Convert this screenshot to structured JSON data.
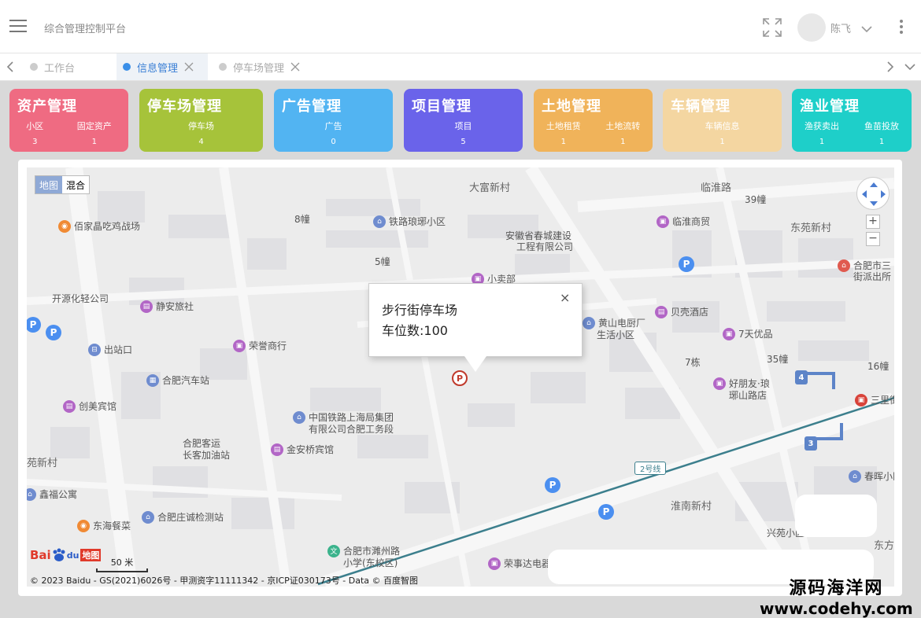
{
  "header": {
    "title": "综合管理控制平台",
    "username": "陈飞"
  },
  "tabs": [
    {
      "label": "工作台",
      "active": false
    },
    {
      "label": "信息管理",
      "active": true
    },
    {
      "label": "停车场管理",
      "active": false
    }
  ],
  "modules": [
    {
      "title": "资产管理",
      "color": "#ef6b82",
      "items": [
        {
          "label": "小区",
          "count": "3"
        },
        {
          "label": "固定资产",
          "count": "1"
        }
      ]
    },
    {
      "title": "停车场管理",
      "color": "#a6c33a",
      "items": [
        {
          "label": "停车场",
          "count": "4"
        }
      ]
    },
    {
      "title": "广告管理",
      "color": "#52b4f2",
      "items": [
        {
          "label": "广告",
          "count": "0"
        }
      ]
    },
    {
      "title": "项目管理",
      "color": "#6a63ea",
      "items": [
        {
          "label": "项目",
          "count": "5"
        }
      ]
    },
    {
      "title": "土地管理",
      "color": "#f0b35a",
      "items": [
        {
          "label": "土地租赁",
          "count": "1"
        },
        {
          "label": "土地流转",
          "count": "1"
        }
      ]
    },
    {
      "title": "车辆管理",
      "color": "#f4d6a1",
      "items": [
        {
          "label": "车辆信息",
          "count": "1"
        }
      ]
    },
    {
      "title": "渔业管理",
      "color": "#1ecfc9",
      "items": [
        {
          "label": "渔获卖出",
          "count": "1"
        },
        {
          "label": "鱼苗投放",
          "count": "1"
        }
      ]
    }
  ],
  "map": {
    "type_options": [
      "地图",
      "混合"
    ],
    "selected_type": "地图",
    "popup": {
      "title": "步行街停车场",
      "body": "车位数:100",
      "close": "×"
    },
    "marker_symbol": "P",
    "zoom_in": "+",
    "zoom_out": "−",
    "scale_label": "50 米",
    "copyright": "© 2023 Baidu - GS(2021)6026号 - 甲测资字11111342 - 京ICP证030173号 - Data © 百度智图",
    "logo_text_1": "Bai",
    "logo_text_2": "du",
    "logo_text_3": "地图",
    "pois": [
      {
        "name": "大富新村",
        "style": "big"
      },
      {
        "name": "临淮路",
        "style": "big"
      },
      {
        "name": "39幢",
        "style": "plain"
      },
      {
        "name": "8幢",
        "style": "plain"
      },
      {
        "name": "铁路琅琊小区",
        "style": "pin",
        "color": "#6f8ccf",
        "icon": "⌂"
      },
      {
        "name": "安徽省春城建设",
        "style": "plain"
      },
      {
        "name": "工程有限公司",
        "style": "plain"
      },
      {
        "name": "临淮商贸",
        "style": "pin",
        "color": "#b266c6",
        "icon": "▣"
      },
      {
        "name": "东苑新村",
        "style": "big"
      },
      {
        "name": "佰家晶吃鸡战场",
        "style": "pin",
        "color": "#f08a34",
        "icon": "◉"
      },
      {
        "name": "5幢",
        "style": "plain"
      },
      {
        "name": "小卖部",
        "style": "pin",
        "color": "#b266c6",
        "icon": "▣"
      },
      {
        "name": "合肥市三",
        "style": "pin",
        "color": "#e05a4f",
        "icon": "⌂"
      },
      {
        "name": "街派出所",
        "style": "plain"
      },
      {
        "name": "开源化轻公司",
        "style": "plain"
      },
      {
        "name": "静安旅社",
        "style": "pin",
        "color": "#b266c6",
        "icon": "▤"
      },
      {
        "name": "黄山电厨厂",
        "style": "pin",
        "color": "#6f8ccf",
        "icon": "⌂"
      },
      {
        "name": "生活小区",
        "style": "plain"
      },
      {
        "name": "贝壳酒店",
        "style": "pin",
        "color": "#b266c6",
        "icon": "▤"
      },
      {
        "name": "出站口",
        "style": "pin",
        "color": "#6f8ccf",
        "icon": "⊟"
      },
      {
        "name": "荣誉商行",
        "style": "pin",
        "color": "#b266c6",
        "icon": "▣"
      },
      {
        "name": "7天优品",
        "style": "pin",
        "color": "#b266c6",
        "icon": "▣"
      },
      {
        "name": "7栋",
        "style": "plain"
      },
      {
        "name": "35幢",
        "style": "plain"
      },
      {
        "name": "16幢",
        "style": "plain"
      },
      {
        "name": "合肥汽车站",
        "style": "pin",
        "color": "#6f8ccf",
        "icon": "▦"
      },
      {
        "name": "好朋友·琅",
        "style": "pin",
        "color": "#b266c6",
        "icon": "▣"
      },
      {
        "name": "琊山路店",
        "style": "plain"
      },
      {
        "name": "创美宾馆",
        "style": "pin",
        "color": "#b266c6",
        "icon": "▤"
      },
      {
        "name": "中国铁路上海局集团",
        "style": "pin",
        "color": "#6f8ccf",
        "icon": "⌂"
      },
      {
        "name": "有限公司合肥工务段",
        "style": "plain"
      },
      {
        "name": "三里街",
        "style": "pin",
        "color": "#d8433a",
        "icon": "▣"
      },
      {
        "name": "合肥客运",
        "style": "plain"
      },
      {
        "name": "长客加油站",
        "style": "plain"
      },
      {
        "name": "金安桥宾馆",
        "style": "pin",
        "color": "#b266c6",
        "icon": "▤"
      },
      {
        "name": "苑新村",
        "style": "big"
      },
      {
        "name": "2号线",
        "style": "line"
      },
      {
        "name": "鑫福公寓",
        "style": "pin",
        "color": "#6f8ccf",
        "icon": "⌂"
      },
      {
        "name": "淮南新村",
        "style": "big"
      },
      {
        "name": "春晖小区",
        "style": "pin",
        "color": "#6f8ccf",
        "icon": "⌂"
      },
      {
        "name": "东海餐菜",
        "style": "pin",
        "color": "#f08a34",
        "icon": "◉"
      },
      {
        "name": "合肥庄诚检测站",
        "style": "pin",
        "color": "#6f8ccf",
        "icon": "⌂"
      },
      {
        "name": "兴苑小区",
        "style": "plain"
      },
      {
        "name": "合肥市濉州路",
        "style": "pin",
        "color": "#3bb38c",
        "icon": "文"
      },
      {
        "name": "小学(东校区)",
        "style": "plain"
      },
      {
        "name": "荣事达电器",
        "style": "pin",
        "color": "#b266c6",
        "icon": "▣"
      },
      {
        "name": "东方",
        "style": "big"
      }
    ],
    "route_markers": [
      "4",
      "3"
    ]
  },
  "watermark": {
    "line1": "源码海洋网",
    "line2": "www.codehy.com"
  }
}
